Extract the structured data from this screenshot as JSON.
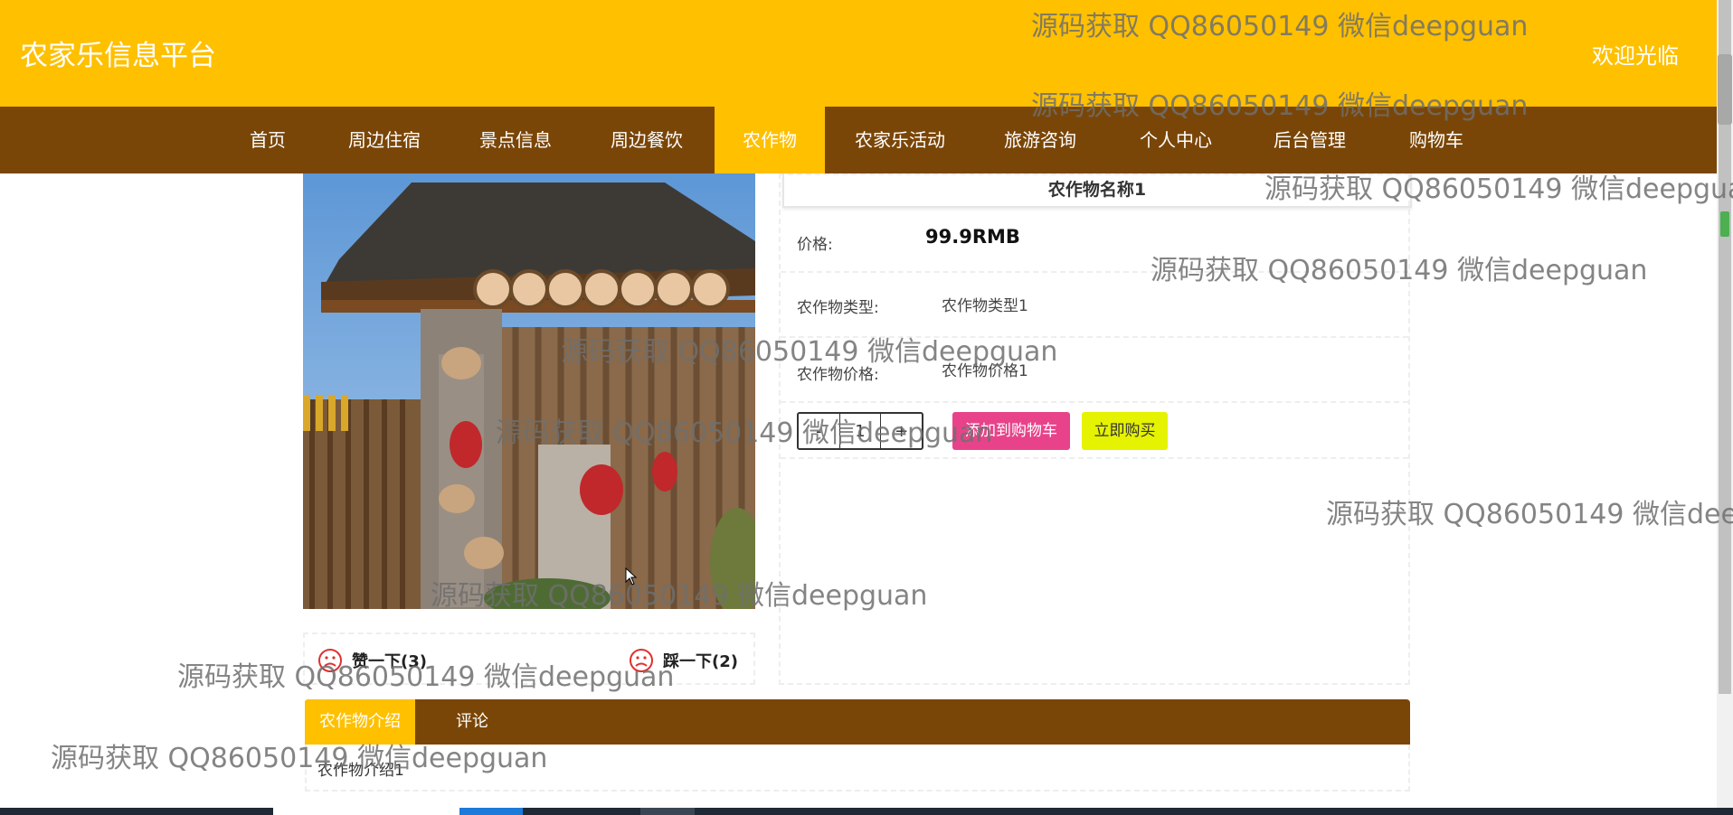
{
  "header": {
    "site_title": "农家乐信息平台",
    "welcome": "欢迎光临"
  },
  "nav": {
    "items": [
      {
        "label": "首页"
      },
      {
        "label": "周边住宿"
      },
      {
        "label": "景点信息"
      },
      {
        "label": "周边餐饮"
      },
      {
        "label": "农作物",
        "active": true
      },
      {
        "label": "农家乐活动"
      },
      {
        "label": "旅游咨询"
      },
      {
        "label": "个人中心"
      },
      {
        "label": "后台管理"
      },
      {
        "label": "购物车"
      }
    ]
  },
  "product": {
    "name": "农作物名称1",
    "price_label": "价格:",
    "price_value": "99.9RMB",
    "type_label": "农作物类型:",
    "type_value": "农作物类型1",
    "crop_price_label": "农作物价格:",
    "crop_price_value": "农作物价格1",
    "quantity": {
      "minus": "-",
      "value": "1",
      "plus": "+"
    },
    "add_to_cart": "添加到购物车",
    "buy_now": "立即购买"
  },
  "votes": {
    "like": "赞一下(3)",
    "dislike": "踩一下(2)"
  },
  "tabs": {
    "items": [
      {
        "label": "农作物介绍",
        "active": true
      },
      {
        "label": "评论"
      }
    ],
    "content": "农作物介绍1"
  },
  "watermark_text": "源码获取 QQ86050149 微信deepguan",
  "colors": {
    "header": "#FFC000",
    "nav": "#7A4607",
    "cart_button": "#E8438A",
    "buy_button": "#E5F200"
  }
}
